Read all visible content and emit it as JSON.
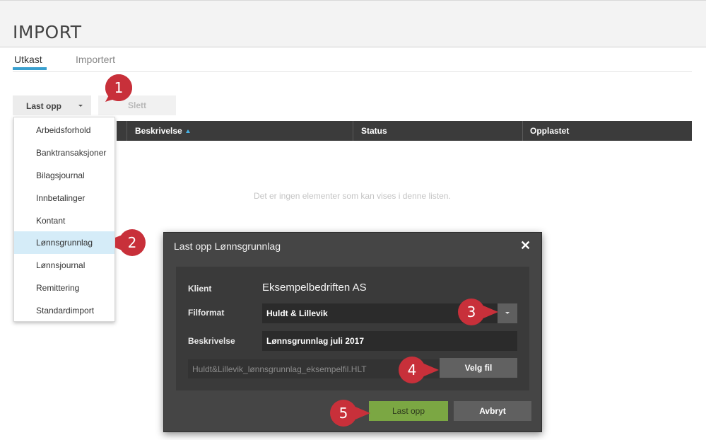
{
  "page": {
    "title": "IMPORT"
  },
  "tabs": [
    {
      "label": "Utkast",
      "active": true
    },
    {
      "label": "Importert",
      "active": false
    }
  ],
  "toolbar": {
    "upload_label": "Last opp",
    "delete_label": "Slett"
  },
  "table": {
    "columns": [
      "Beskrivelse",
      "Status",
      "Opplastet"
    ],
    "sort_column": "Beskrivelse",
    "sort_direction": "ascending",
    "empty_message": "Det er ingen elementer som kan vises i denne listen."
  },
  "dropdown": {
    "items": [
      "Arbeidsforhold",
      "Banktransaksjoner",
      "Bilagsjournal",
      "Innbetalinger",
      "Kontant",
      "Lønnsgrunnlag",
      "Lønnsjournal",
      "Remittering",
      "Standardimport"
    ],
    "selected": "Lønnsgrunnlag"
  },
  "dialog": {
    "title": "Last opp Lønnsgrunnlag",
    "klient_label": "Klient",
    "klient_value": "Eksempelbedriften AS",
    "filformat_label": "Filformat",
    "filformat_value": "Huldt & Lillevik",
    "beskrivelse_label": "Beskrivelse",
    "beskrivelse_value": "Lønnsgrunnlag juli 2017",
    "file_name": "Huldt&Lillevik_lønnsgrunnlag_eksempelfil.HLT",
    "choose_file_label": "Velg fil",
    "submit_label": "Last opp",
    "cancel_label": "Avbryt"
  },
  "callouts": [
    "1",
    "2",
    "3",
    "4",
    "5"
  ],
  "icons": {
    "close": "close-icon",
    "sort": "sort-asc-icon",
    "dropdown": "chevron-down-icon"
  },
  "colors": {
    "accent": "#3aa0cf",
    "table_header": "#3b3b3b",
    "callout": "#c8303a",
    "submit": "#7ba743",
    "selected_row": "#d5ecf8"
  }
}
